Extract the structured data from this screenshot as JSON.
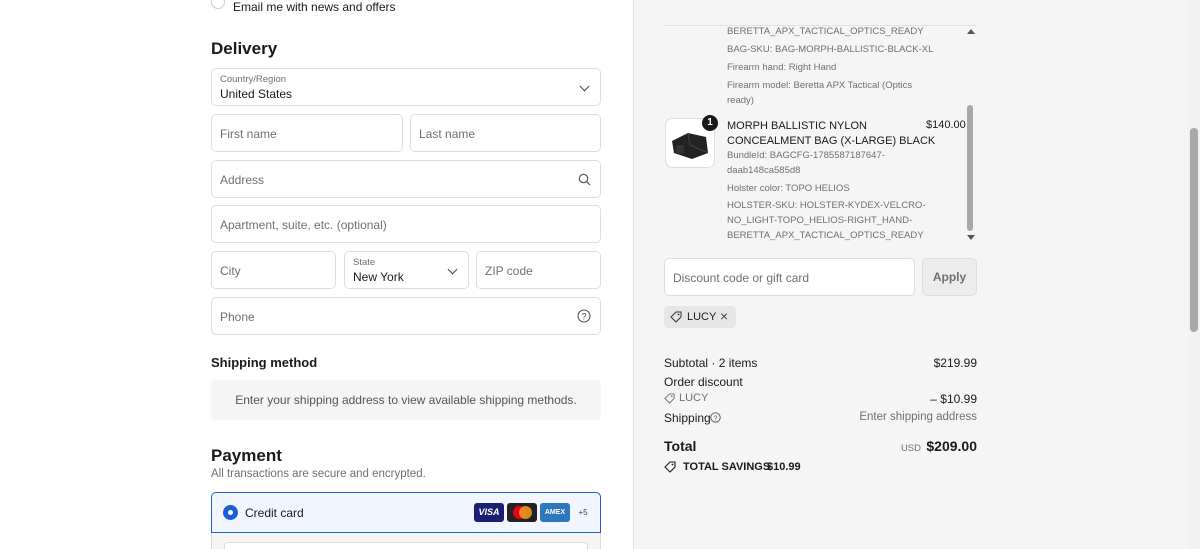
{
  "newsletter": {
    "label": "Email me with news and offers"
  },
  "delivery": {
    "heading": "Delivery",
    "country": {
      "label": "Country/Region",
      "value": "United States"
    },
    "first_name_placeholder": "First name",
    "last_name_placeholder": "Last name",
    "address_placeholder": "Address",
    "apartment_placeholder": "Apartment, suite, etc. (optional)",
    "city_placeholder": "City",
    "state": {
      "label": "State",
      "value": "New York"
    },
    "zip_placeholder": "ZIP code",
    "phone_placeholder": "Phone"
  },
  "shipping_method": {
    "heading": "Shipping method",
    "message": "Enter your shipping address to view available shipping methods."
  },
  "payment": {
    "heading": "Payment",
    "subheading": "All transactions are secure and encrypted.",
    "option_label": "Credit card",
    "card_brands": [
      "VISA",
      "MC",
      "AMEX"
    ],
    "more_cards": "+5"
  },
  "order": {
    "prev_item_details": [
      "BERETTA_APX_TACTICAL_OPTICS_READY",
      "BAG-SKU: BAG-MORPH-BALLISTIC-BLACK-XL",
      "Firearm hand: Right Hand",
      "Firearm model: Beretta APX Tactical (Optics",
      "ready)"
    ],
    "item": {
      "quantity": "1",
      "title_line1": "MORPH BALLISTIC NYLON",
      "title_line2": "CONCEALMENT BAG (X-LARGE) BLACK",
      "price": "$140.00",
      "details": [
        "BundleId: BAGCFG-1785587187647-",
        "daab148ca585d8",
        "Holster color: TOPO HELIOS",
        "HOLSTER-SKU: HOLSTER-KYDEX-VELCRO-",
        "NO_LIGHT-TOPO_HELIOS-RIGHT_HAND-",
        "BERETTA_APX_TACTICAL_OPTICS_READY"
      ]
    },
    "discount_placeholder": "Discount code or gift card",
    "apply_label": "Apply",
    "applied_code": "LUCY"
  },
  "summary": {
    "subtotal_label": "Subtotal · 2 items",
    "subtotal_value": "$219.99",
    "order_discount_label": "Order discount",
    "discount_code": "LUCY",
    "discount_value": "– $10.99",
    "shipping_label": "Shipping",
    "shipping_value": "Enter shipping address",
    "total_label": "Total",
    "currency": "USD",
    "total_value": "$209.00",
    "savings_label": "TOTAL SAVINGS",
    "savings_value": "$10.99"
  },
  "colors": {
    "accent": "#1a5fd6",
    "background_right": "#f5f5f5",
    "border": "#dedede"
  }
}
